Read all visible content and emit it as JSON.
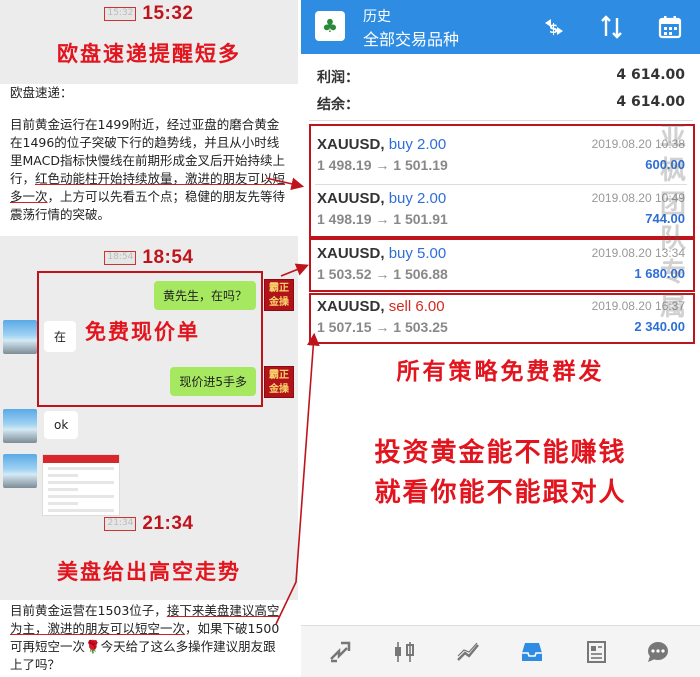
{
  "left": {
    "times": [
      {
        "chip": "15:32",
        "big": "15:32"
      },
      {
        "chip": "18:54",
        "big": "18:54"
      },
      {
        "chip": "21:34",
        "big": "21:34"
      }
    ],
    "headline1": "欧盘速递提醒短多",
    "article1": {
      "intro": "欧盘速递：",
      "body_plain": "目前黄金运行在1499附近，经过亚盘的磨合黄金在1496的位子突破下行的趋势线，并且从小时线里MACD指标快慢线在前期形成金叉后开始持续上行，",
      "body_underlined": "红色动能柱开始持续放量，激进的朋友可以短多一次",
      "body_tail": "，上方可以先看五个点；稳健的朋友先等待震荡行情的突破。"
    },
    "chat": {
      "msg1": "黄先生，在吗？",
      "reply1": "在",
      "free_label": "免费现价单",
      "msg2": "现价进5手多",
      "reply2": "ok",
      "self_avatar_text": "霸正金操"
    },
    "headline2": "美盘给出高空走势",
    "article2": {
      "body_plain1": "目前黄金运营在1503位子，",
      "body_underlined": "接下来美盘建议高空为主，激进的朋友可以短空一次",
      "body_tail": "，如果下破1500可再短空一次🌹今天给了这么多操作建议朋友跟上了吗？"
    }
  },
  "right": {
    "header": {
      "title": "历史",
      "subtitle": "全部交易品种"
    },
    "toolbar_icons": [
      "currency-exchange-icon",
      "sort-icon",
      "calendar-icon"
    ],
    "summary": [
      {
        "label": "利润：",
        "value": "4 614.00"
      },
      {
        "label": "结余：",
        "value": "4 614.00"
      }
    ],
    "trades": [
      {
        "symbol": "XAUUSD,",
        "dir": "buy 2.00",
        "side": "buy",
        "open": "1 498.19",
        "close": "1 501.19",
        "date": "2019.08.20 10:38",
        "profit": "600.00"
      },
      {
        "symbol": "XAUUSD,",
        "dir": "buy 2.00",
        "side": "buy",
        "open": "1 498.19",
        "close": "1 501.91",
        "date": "2019.08.20 10:49",
        "profit": "744.00"
      },
      {
        "symbol": "XAUUSD,",
        "dir": "buy 5.00",
        "side": "buy",
        "open": "1 503.52",
        "close": "1 506.88",
        "date": "2019.08.20 13:34",
        "profit": "1 680.00"
      },
      {
        "symbol": "XAUUSD,",
        "dir": "sell 6.00",
        "side": "sell",
        "open": "1 507.15",
        "close": "1 503.25",
        "date": "2019.08.20 16:37",
        "profit": "2 340.00"
      }
    ],
    "arrow_glyph": "→",
    "watermark": "亚枫团队专属",
    "caption1": "所有策略免费群发",
    "caption2_line1": "投资黄金能不能赚钱",
    "caption2_line2": "就看你能不能跟对人",
    "nav_icons": [
      "trade-icon",
      "candlestick-icon",
      "chart-icon",
      "history-inbox-icon",
      "news-icon",
      "chat-icon"
    ]
  }
}
